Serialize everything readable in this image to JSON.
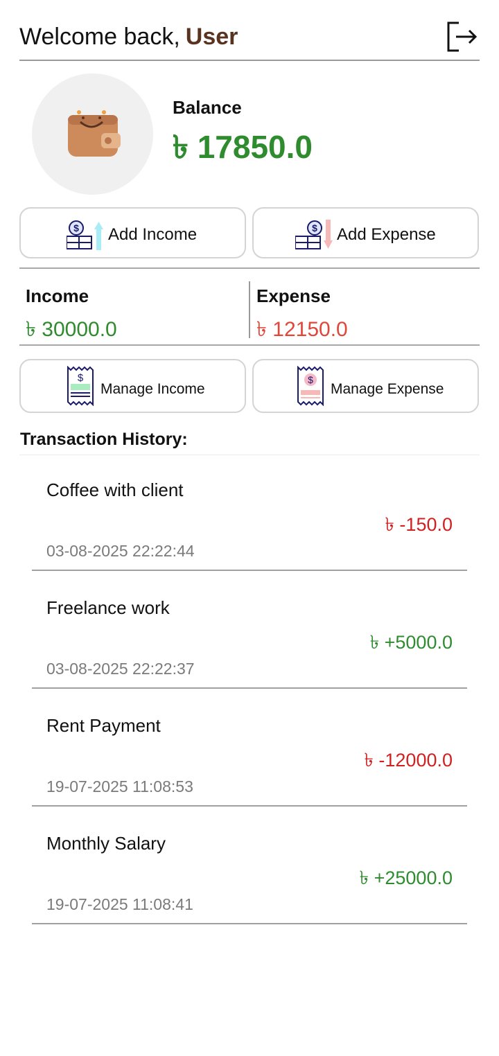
{
  "header": {
    "welcome_text": "Welcome back,",
    "username": "User",
    "logout_icon": "logout-icon"
  },
  "balance": {
    "label": "Balance",
    "value": "৳ 17850.0",
    "icon": "wallet-icon"
  },
  "actions": {
    "add_income": "Add Income",
    "add_expense": "Add Expense"
  },
  "summary": {
    "income_label": "Income",
    "income_value": "৳ 30000.0",
    "expense_label": "Expense",
    "expense_value": "৳ 12150.0"
  },
  "manage": {
    "income": "Manage Income",
    "expense": "Manage Expense"
  },
  "history": {
    "title": "Transaction History:",
    "items": [
      {
        "title": "Coffee with client",
        "amount": "৳ -150.0",
        "date": "03-08-2025 22:22:44",
        "type": "expense"
      },
      {
        "title": "Freelance work",
        "amount": "৳ +5000.0",
        "date": "03-08-2025 22:22:37",
        "type": "income"
      },
      {
        "title": "Rent Payment",
        "amount": "৳ -12000.0",
        "date": "19-07-2025 11:08:53",
        "type": "expense"
      },
      {
        "title": "Monthly Salary",
        "amount": "৳ +25000.0",
        "date": "19-07-2025 11:08:41",
        "type": "income"
      }
    ]
  },
  "colors": {
    "positive": "#2e8b2e",
    "negative": "#d21f1f",
    "username": "#5a3320"
  }
}
